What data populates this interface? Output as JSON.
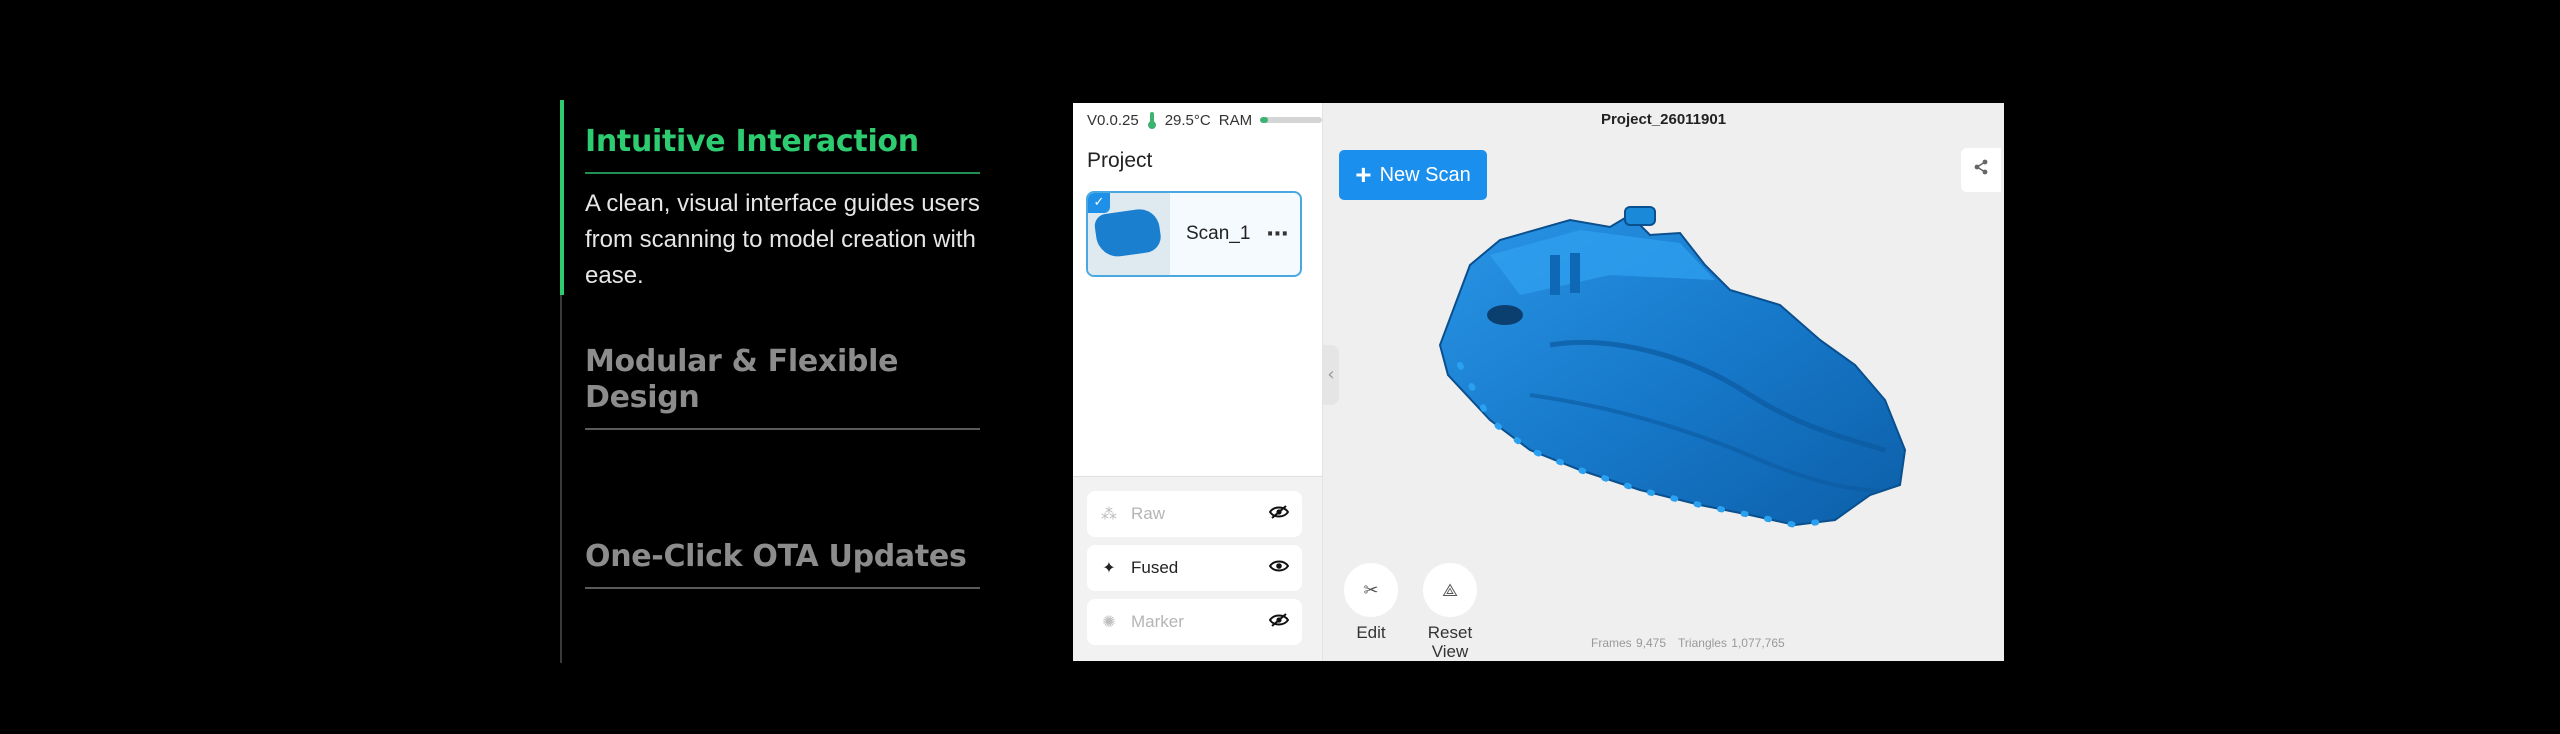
{
  "features": [
    {
      "title": "Intuitive Interaction",
      "description": "A clean, visual interface guides users from scanning to model creation with ease.",
      "active": true
    },
    {
      "title": "Modular & Flexible Design",
      "active": false
    },
    {
      "title": "One-Click OTA Updates",
      "active": false
    }
  ],
  "app": {
    "status": {
      "version": "V0.0.25",
      "temperature": "29.5°C",
      "ram_label": "RAM",
      "ram_usage": 0.12
    },
    "project_heading": "Project",
    "project_title": "Project_26011901",
    "scans": [
      {
        "name": "Scan_1",
        "selected": true
      }
    ],
    "more_icon": "⋯",
    "new_scan_label": "New Scan",
    "layers": [
      {
        "name": "Raw",
        "icon": "raw-icon",
        "visible": false
      },
      {
        "name": "Fused",
        "icon": "fused-icon",
        "visible": true
      },
      {
        "name": "Marker",
        "icon": "marker-icon",
        "visible": false
      }
    ],
    "tools": {
      "edit_label": "Edit",
      "reset_label_1": "Reset",
      "reset_label_2": "View"
    },
    "stats": {
      "frames": "Frames 9,475",
      "triangles": "Triangles 1,077,765"
    },
    "colors": {
      "accent": "#2ecc71",
      "primary": "#1a8fee",
      "model": "#1a7fcf"
    }
  }
}
